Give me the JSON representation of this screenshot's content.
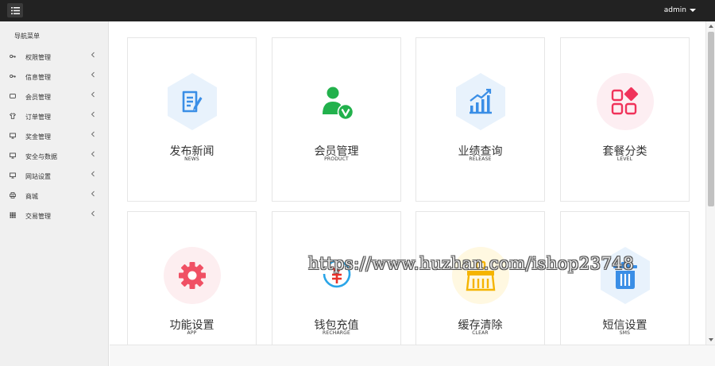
{
  "header": {
    "menu_icon": "list-icon",
    "user_name": "admin"
  },
  "sidebar": {
    "title": "导航菜单",
    "items": [
      {
        "label": "权限管理",
        "icon": "key-icon"
      },
      {
        "label": "信息管理",
        "icon": "key-icon"
      },
      {
        "label": "会员管理",
        "icon": "card-icon"
      },
      {
        "label": "订单管理",
        "icon": "shirt-icon"
      },
      {
        "label": "奖金管理",
        "icon": "monitor-icon"
      },
      {
        "label": "安全与数据",
        "icon": "monitor-icon"
      },
      {
        "label": "网站设置",
        "icon": "monitor-icon"
      },
      {
        "label": "商城",
        "icon": "printer-icon"
      },
      {
        "label": "交易管理",
        "icon": "grid-icon"
      }
    ]
  },
  "cards": [
    {
      "title": "发布新闻",
      "sub": "NEWS",
      "icon": "edit-document-icon",
      "color": "#3a8ee6"
    },
    {
      "title": "会员管理",
      "sub": "PRODUCT",
      "icon": "user-check-icon",
      "color": "#22b14c"
    },
    {
      "title": "业绩查询",
      "sub": "RELEASE",
      "icon": "bar-chart-icon",
      "color": "#3a8ee6"
    },
    {
      "title": "套餐分类",
      "sub": "LEVEL",
      "icon": "category-icon",
      "color": "#f0325a"
    },
    {
      "title": "功能设置",
      "sub": "APP",
      "icon": "gear-icon",
      "color": "#f05064"
    },
    {
      "title": "钱包充值",
      "sub": "RECHARGE",
      "icon": "yuan-recharge-icon",
      "color": "#e8322a"
    },
    {
      "title": "缓存清除",
      "sub": "CLEAR",
      "icon": "broom-icon",
      "color": "#f5b400"
    },
    {
      "title": "短信设置",
      "sub": "SMS",
      "icon": "trash-icon",
      "color": "#3a8ee6"
    }
  ],
  "watermark": "https://www.huzhan.com/ishop23748"
}
